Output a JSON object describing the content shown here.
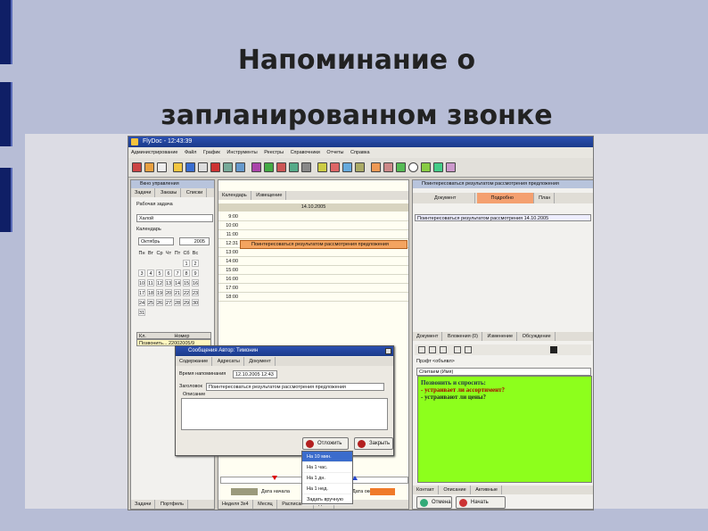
{
  "slide": {
    "title_line1": "Напоминание о",
    "title_line2": "запланированном звонке"
  },
  "app": {
    "title": "FlyDoc - 12:43:39",
    "menu": [
      "Администрирование",
      "Файл",
      "График",
      "Инструменты",
      "Реестры",
      "Справочники",
      "Отчеты",
      "Справка"
    ]
  },
  "left_pane": {
    "header": "Вкно управления",
    "tabs": [
      "Задачи",
      "Заказы",
      "Списки",
      "Календарь",
      "Извещение"
    ],
    "worker_label": "Рабочая задача",
    "worker_value": "Халой",
    "calendar_label": "Календарь",
    "month": "Октябрь",
    "year": "2005",
    "weekdays": [
      "Пн",
      "Вт",
      "Ср",
      "Чт",
      "Пт",
      "Сб",
      "Вс"
    ],
    "weeks": [
      [
        "",
        "",
        "",
        "",
        "",
        "1",
        "2"
      ],
      [
        "3",
        "4",
        "5",
        "6",
        "7",
        "8",
        "9"
      ],
      [
        "10",
        "11",
        "12",
        "13",
        "14",
        "15",
        "16"
      ],
      [
        "17",
        "18",
        "19",
        "20",
        "21",
        "22",
        "23"
      ],
      [
        "24",
        "25",
        "26",
        "27",
        "28",
        "29",
        "30"
      ],
      [
        "31",
        "",
        "",
        "",
        "",
        "",
        ""
      ]
    ],
    "list_header1": "Кл.",
    "list_header2": "Номер",
    "list_item": "Позвонить... 22002005/9",
    "bottom_tabs": [
      "Задачи",
      "Портфель"
    ]
  },
  "schedule": {
    "date": "14.10.2005",
    "times": [
      "9:00",
      "10:00",
      "11:00",
      "12:31",
      "13:00",
      "14:00",
      "15:00",
      "16:00",
      "17:00",
      "18:00"
    ],
    "event": "Поинтересоваться результатом рассмотрения предложения",
    "bottom_tabs": [
      "Неделя 3x4",
      "Месяц",
      "Расписание",
      "Дела"
    ]
  },
  "right_pane": {
    "header": "Поинтересоваться результатом рассмотрения предложения",
    "tabs": [
      "Документ",
      "Подробно",
      "План"
    ],
    "row": "Поинтересоваться результатом рассмотрения 14.10.2005",
    "lower_tabs": [
      "Документ",
      "Вложения (0)",
      "Изменение",
      "Обсуждение"
    ],
    "subject_label": "Прэфт",
    "subject_value": "<объявл>",
    "contact_label": "Спитаем (Имя)",
    "green_line1": "Позвонить и спросить:",
    "green_line2": "- устраивает ли ассортимент?",
    "green_line3": "- устраивают ли цены?",
    "bottom_tabs": [
      "Контакт",
      "Описание",
      "Активные"
    ],
    "btn_cancel": "Отмена",
    "btn_start": "Начать работу"
  },
  "dialog": {
    "title": "Сообщения Автор: Тимонин",
    "tabs": [
      "Содержание",
      "Адресаты",
      "Документ"
    ],
    "time_label": "Время напоминания",
    "time_value": "12.10.2005 12:43",
    "subject_label": "Заголовок",
    "subject_value": "Поинтересоваться результатом рассмотрения предложения",
    "desc_label": "Описание",
    "btn_postpone": "Отложить",
    "btn_close": "Закрыть",
    "options": [
      "На 10 мин.",
      "На 1 час.",
      "На 1 дн.",
      "На 1 нед.",
      "Задать вручную"
    ]
  },
  "footer": {
    "start_label": "Дата начала",
    "end_label": "Дата оконч."
  },
  "colors": {
    "event": "#f4a460",
    "green": "#8dff1c",
    "accent": "#1a3a8a"
  }
}
